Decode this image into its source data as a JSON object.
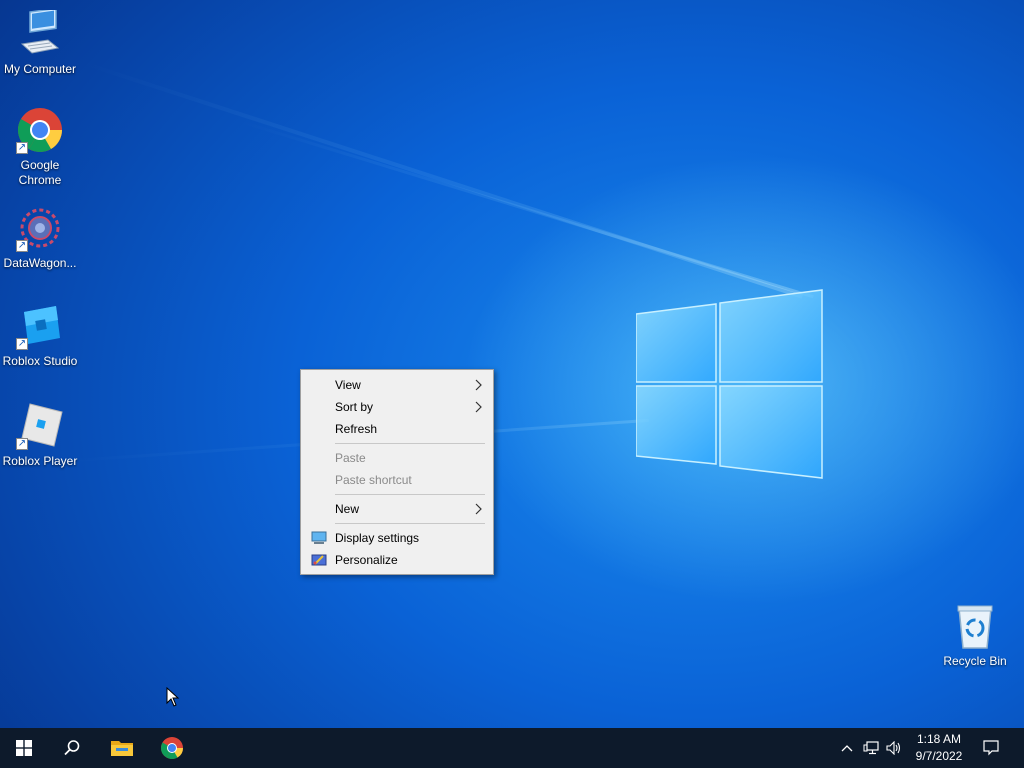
{
  "desktop": {
    "icons": [
      {
        "label": "My Computer",
        "icon": "computer-icon"
      },
      {
        "label": "Google Chrome",
        "icon": "chrome-icon"
      },
      {
        "label": "DataWagon...",
        "icon": "datawagon-icon"
      },
      {
        "label": "Roblox Studio",
        "icon": "roblox-studio-icon"
      },
      {
        "label": "Roblox Player",
        "icon": "roblox-player-icon"
      },
      {
        "label": "Recycle Bin",
        "icon": "recycle-bin-icon"
      }
    ]
  },
  "context_menu": {
    "items": [
      {
        "label": "View",
        "submenu": true,
        "enabled": true
      },
      {
        "label": "Sort by",
        "submenu": true,
        "enabled": true
      },
      {
        "label": "Refresh",
        "submenu": false,
        "enabled": true
      },
      {
        "label": "Paste",
        "submenu": false,
        "enabled": false
      },
      {
        "label": "Paste shortcut",
        "submenu": false,
        "enabled": false
      },
      {
        "label": "New",
        "submenu": true,
        "enabled": true
      },
      {
        "label": "Display settings",
        "icon": "display-settings-icon",
        "enabled": true
      },
      {
        "label": "Personalize",
        "icon": "personalize-icon",
        "enabled": true
      }
    ]
  },
  "taskbar": {
    "pinned": [
      "start-icon",
      "search-icon",
      "file-explorer-icon",
      "chrome-icon"
    ],
    "tray_icons": [
      "chevron-up-icon",
      "network-icon",
      "volume-icon"
    ],
    "time": "1:18 AM",
    "date": "9/7/2022",
    "notification_icon": "action-center-icon"
  },
  "colors": {
    "taskbar_bg": "#0d1a2b",
    "menu_bg": "#f0f0f0",
    "wallpaper_blue": "#0a62d6"
  }
}
